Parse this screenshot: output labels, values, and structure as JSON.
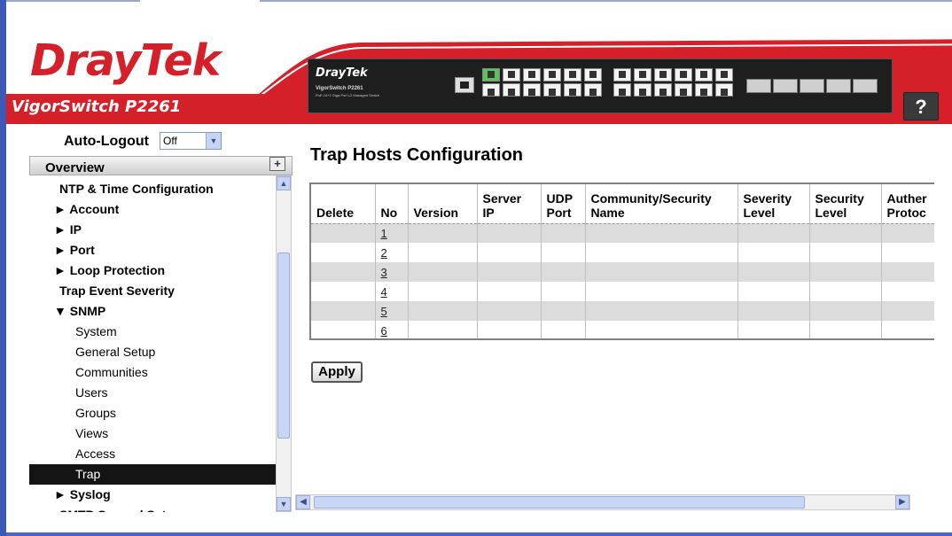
{
  "header": {
    "logo": "DrayTek",
    "model": "VigorSwitch P2261",
    "help_label": "?",
    "device": {
      "brand": "DrayTek",
      "model": "VigorSwitch P2261",
      "desc": "PoE 24+2 Giga Port L2 Managed Switch"
    }
  },
  "autologout": {
    "label": "Auto-Logout",
    "value": "Off"
  },
  "overview": {
    "label": "Overview",
    "plus": "+"
  },
  "nav": {
    "items": [
      {
        "label": "NTP & Time Configuration",
        "indent": 34,
        "bold": true,
        "selected": false
      },
      {
        "label": "► Account",
        "indent": 28,
        "bold": true,
        "selected": false
      },
      {
        "label": "► IP",
        "indent": 28,
        "bold": true,
        "selected": false
      },
      {
        "label": "► Port",
        "indent": 28,
        "bold": true,
        "selected": false
      },
      {
        "label": "► Loop Protection",
        "indent": 28,
        "bold": true,
        "selected": false
      },
      {
        "label": "Trap Event Severity",
        "indent": 34,
        "bold": true,
        "selected": false
      },
      {
        "label": "▼ SNMP",
        "indent": 28,
        "bold": true,
        "selected": false
      },
      {
        "label": "System",
        "indent": 52,
        "bold": false,
        "selected": false
      },
      {
        "label": "General Setup",
        "indent": 52,
        "bold": false,
        "selected": false
      },
      {
        "label": "Communities",
        "indent": 52,
        "bold": false,
        "selected": false
      },
      {
        "label": "Users",
        "indent": 52,
        "bold": false,
        "selected": false
      },
      {
        "label": "Groups",
        "indent": 52,
        "bold": false,
        "selected": false
      },
      {
        "label": "Views",
        "indent": 52,
        "bold": false,
        "selected": false
      },
      {
        "label": "Access",
        "indent": 52,
        "bold": false,
        "selected": false
      },
      {
        "label": "Trap",
        "indent": 52,
        "bold": false,
        "selected": true
      },
      {
        "label": "► Syslog",
        "indent": 28,
        "bold": true,
        "selected": false
      },
      {
        "label": "SMTP General Setup",
        "indent": 34,
        "bold": true,
        "selected": false
      }
    ]
  },
  "main": {
    "title": "Trap Hosts Configuration",
    "columns": [
      {
        "l1": "",
        "l2": "Delete",
        "w": 72
      },
      {
        "l1": "",
        "l2": "No",
        "w": 37
      },
      {
        "l1": "",
        "l2": "Version",
        "w": 78
      },
      {
        "l1": "Server",
        "l2": "IP",
        "w": 72
      },
      {
        "l1": "UDP",
        "l2": "Port",
        "w": 50
      },
      {
        "l1": "Community/Security",
        "l2": "Name",
        "w": 172
      },
      {
        "l1": "Severity",
        "l2": "Level",
        "w": 81
      },
      {
        "l1": "Security",
        "l2": "Level",
        "w": 81
      },
      {
        "l1": "Auther",
        "l2": "Protoc",
        "w": 80
      }
    ],
    "rows": [
      "1",
      "2",
      "3",
      "4",
      "5",
      "6"
    ],
    "apply_label": "Apply"
  },
  "colors": {
    "brand_red": "#d5202a",
    "frame_blue": "#3b5ab8",
    "row_gray": "#dcdcdc",
    "selected_nav": "#141414"
  }
}
